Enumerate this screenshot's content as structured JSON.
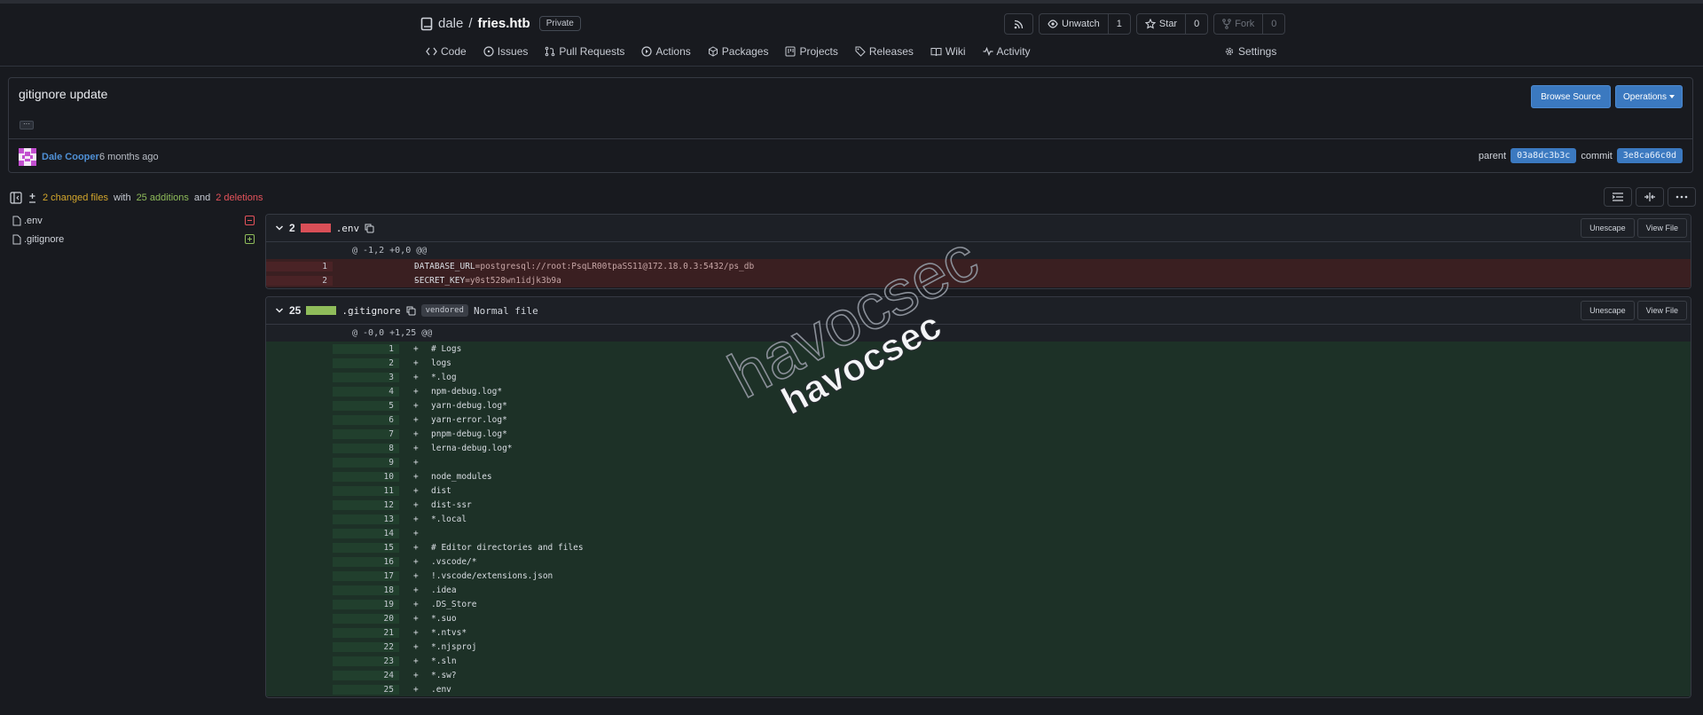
{
  "repo": {
    "owner": "dale",
    "separator": "/",
    "name": "fries.htb",
    "visibility": "Private",
    "actions": {
      "unwatch_label": "Unwatch",
      "watch_count": "1",
      "star_label": "Star",
      "star_count": "0",
      "fork_label": "Fork",
      "fork_count": "0"
    },
    "nav": {
      "code": "Code",
      "issues": "Issues",
      "pull_requests": "Pull Requests",
      "actions": "Actions",
      "packages": "Packages",
      "projects": "Projects",
      "releases": "Releases",
      "wiki": "Wiki",
      "activity": "Activity",
      "settings": "Settings"
    }
  },
  "commit": {
    "title": "gitignore update",
    "browse_source": "Browse Source",
    "operations": "Operations",
    "author": "Dale Cooper",
    "time": "6 months ago",
    "parent_label": "parent",
    "parent_sha": "03a8dc3b3c",
    "commit_label": "commit",
    "commit_sha": "3e8ca66c0d"
  },
  "stats": {
    "changed_files": "2 changed files",
    "with": "with",
    "additions": "25 additions",
    "and": "and",
    "deletions": "2 deletions"
  },
  "tree": [
    {
      "name": ".env",
      "status": "deleted",
      "icon": "file-icon"
    },
    {
      "name": ".gitignore",
      "status": "added",
      "icon": "file-icon"
    }
  ],
  "files": [
    {
      "count": "2",
      "name": ".env",
      "unescape": "Unescape",
      "view_file": "View File",
      "hunk": "@ -1,2 +0,0 @@",
      "lines": [
        {
          "num": "1",
          "sign": "-",
          "key": "DATABASE_URL",
          "value": "=postgresql://root:PsqLR00tpaSS11@172.18.0.3:5432/ps_db"
        },
        {
          "num": "2",
          "sign": "-",
          "key": "SECRET_KEY",
          "value": "=y0st528wn1idjk3b9a"
        }
      ]
    },
    {
      "count": "25",
      "name": ".gitignore",
      "vendored": "vendored",
      "normal_file": "Normal file",
      "unescape": "Unescape",
      "view_file": "View File",
      "hunk": "@ -0,0 +1,25 @@",
      "lines": [
        {
          "num": "1",
          "sign": "+",
          "code": "# Logs"
        },
        {
          "num": "2",
          "sign": "+",
          "code": "logs"
        },
        {
          "num": "3",
          "sign": "+",
          "code": "*.log"
        },
        {
          "num": "4",
          "sign": "+",
          "code": "npm-debug.log*"
        },
        {
          "num": "5",
          "sign": "+",
          "code": "yarn-debug.log*"
        },
        {
          "num": "6",
          "sign": "+",
          "code": "yarn-error.log*"
        },
        {
          "num": "7",
          "sign": "+",
          "code": "pnpm-debug.log*"
        },
        {
          "num": "8",
          "sign": "+",
          "code": "lerna-debug.log*"
        },
        {
          "num": "9",
          "sign": "+",
          "code": ""
        },
        {
          "num": "10",
          "sign": "+",
          "code": "node_modules"
        },
        {
          "num": "11",
          "sign": "+",
          "code": "dist"
        },
        {
          "num": "12",
          "sign": "+",
          "code": "dist-ssr"
        },
        {
          "num": "13",
          "sign": "+",
          "code": "*.local"
        },
        {
          "num": "14",
          "sign": "+",
          "code": ""
        },
        {
          "num": "15",
          "sign": "+",
          "code": "# Editor directories and files"
        },
        {
          "num": "16",
          "sign": "+",
          "code": ".vscode/*"
        },
        {
          "num": "17",
          "sign": "+",
          "code": "!.vscode/extensions.json"
        },
        {
          "num": "18",
          "sign": "+",
          "code": ".idea"
        },
        {
          "num": "19",
          "sign": "+",
          "code": ".DS_Store"
        },
        {
          "num": "20",
          "sign": "+",
          "code": "*.suo"
        },
        {
          "num": "21",
          "sign": "+",
          "code": "*.ntvs*"
        },
        {
          "num": "22",
          "sign": "+",
          "code": "*.njsproj"
        },
        {
          "num": "23",
          "sign": "+",
          "code": "*.sln"
        },
        {
          "num": "24",
          "sign": "+",
          "code": "*.sw?"
        },
        {
          "num": "25",
          "sign": "+",
          "code": ".env"
        }
      ]
    }
  ],
  "watermark": {
    "outline_text": "havocsec",
    "solid_text": "havocsec"
  },
  "colors": {
    "accent": "#3b79c0",
    "added": "#8fbc5a",
    "deleted": "#e5535b",
    "changed": "#d4a72c"
  }
}
